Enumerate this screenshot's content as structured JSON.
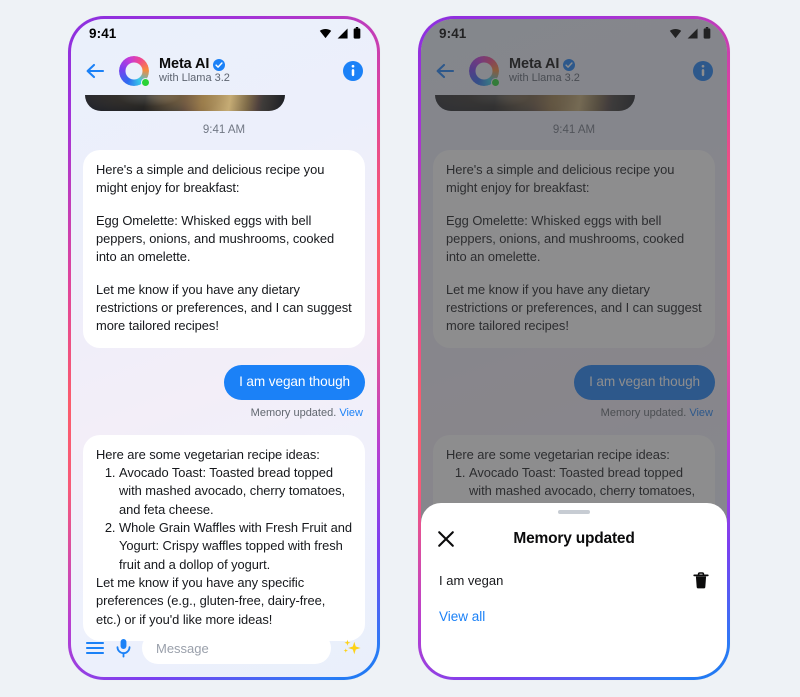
{
  "background_color": "#eef2f6",
  "accent_blue": "#1b81f7",
  "frame_gradient": [
    "#8b2fe0",
    "#e0459a",
    "#fb5c6c",
    "#b83fd0",
    "#7b3ff0",
    "#1877f2"
  ],
  "status_bar": {
    "time": "9:41",
    "icons": [
      "wifi-icon",
      "signal-icon",
      "battery-icon"
    ]
  },
  "app_header": {
    "back_icon": "back-arrow-icon",
    "avatar": "meta-ai-avatar",
    "online_dot_color": "#2ad336",
    "title": "Meta AI",
    "verified_icon": "verified-badge-icon",
    "subtitle": "with Llama 3.2",
    "info_icon": "info-icon"
  },
  "chat": {
    "timestamp": "9:41 AM",
    "ai_message_1": {
      "paragraphs": [
        "Here's a simple and delicious recipe you might enjoy for breakfast:",
        "Egg Omelette: Whisked eggs with bell peppers, onions, and mushrooms, cooked into an omelette.",
        "Let me know if you have any dietary restrictions or preferences, and I can suggest more tailored recipes!"
      ]
    },
    "user_message": "I am vegan though",
    "memory_notice": {
      "text": "Memory updated.",
      "link": "View"
    },
    "ai_message_2": {
      "intro": "Here are some vegetarian recipe ideas:",
      "list": [
        "Avocado Toast: Toasted bread topped with mashed avocado, cherry tomatoes, and feta cheese.",
        "Whole Grain Waffles with Fresh Fruit and Yogurt: Crispy waffles topped with fresh fruit and a dollop of yogurt."
      ],
      "outro": "Let me know if you have any specific preferences (e.g., gluten-free, dairy-free, etc.) or if you'd like more ideas!"
    }
  },
  "composer": {
    "menu_icon": "hamburger-menu-icon",
    "mic_icon": "microphone-icon",
    "placeholder": "Message",
    "sparkle_icon": "sparkle-icon"
  },
  "bottom_sheet": {
    "handle": "drag-handle",
    "close_icon": "close-x-icon",
    "title": "Memory updated",
    "memory_item": "I am vegan",
    "delete_icon": "trash-icon",
    "view_all": "View all"
  }
}
